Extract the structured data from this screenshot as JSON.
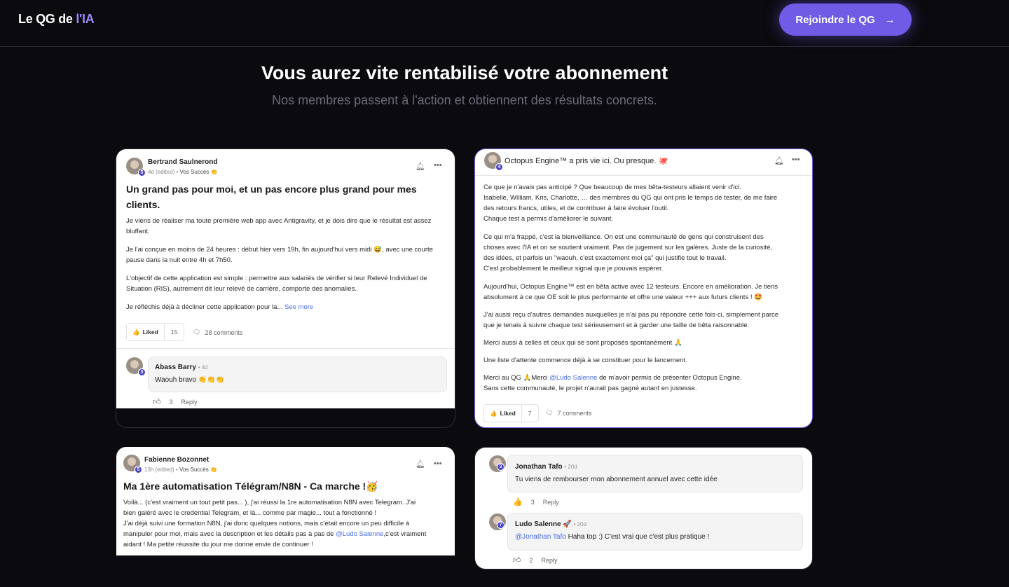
{
  "header": {
    "logo_part1": "Le QG de ",
    "logo_part2": "l'IA",
    "join_label": "Rejoindre le QG",
    "join_arrow": "→"
  },
  "hero": {
    "title": "Vous aurez vite rentabilisé votre abonnement",
    "subtitle": "Nos membres passent à l'action et obtiennent des résultats concrets."
  },
  "post1": {
    "author": "Bertrand Saulnerond",
    "level": "5",
    "time": "4d (edited)",
    "space": "Vos Succès 👏",
    "title": "Un grand pas pour moi, et un pas encore plus grand pour mes clients.",
    "p1": "Je viens de réaliser ma toute première web app avec Antigravity, et je dois dire que le résultat est assez bluffant.",
    "p2": "Je l'ai conçue en moins de 24 heures : début hier vers 19h, fin aujourd'hui vers midi 😅, avec une courte pause dans la nuit entre 4h et 7h50.",
    "p3": "L'objectif de cette application est simple : permettre aux salariés de vérifier si leur Relevé Individuel de Situation (RIS), autrement dit leur relevé de carrière, comporte des anomalies.",
    "p4": "Je réfléchis déjà à décliner cette application pour la...",
    "see_more": "See more",
    "liked_label": "Liked",
    "likes": "15",
    "comments": "28 comments",
    "comment": {
      "author": "Abass Barry",
      "level": "3",
      "time": "4d",
      "text": "Waouh bravo 👏👏👏",
      "likes": "3",
      "reply": "Reply"
    }
  },
  "post2": {
    "author_title": "Octopus Engine™ a pris vie ici. Ou presque. 🐙",
    "level": "4",
    "l1": "Ce que je n'avais pas anticipé ? Que beaucoup de mes bêta-testeurs allaient venir d'ici.",
    "l2": "Isabelle, William, Kris, Charlotte, … des membres du QG qui ont pris le temps de tester, de me faire",
    "l3": "des retours francs, utiles, et de contribuer à faire évoluer l'outil.",
    "l4": "Chaque test a permis d'améliorer le suivant.",
    "l5": "Ce qui m'a frappé, c'est la bienveillance. On est une communauté de gens qui construisent des",
    "l6": "choses avec l'IA et on se soutient vraiment. Pas de jugement sur les galères. Juste de la curiosité,",
    "l7": "des idées, et parfois un \"waouh, c'est exactement moi ça\" qui justifie tout le travail.",
    "l8": "C'est probablement le meilleur signal que je pouvais espérer.",
    "l9": "Aujourd'hui, Octopus Engine™ est en bêta active avec 12 testeurs. Encore en amélioration. Je tiens",
    "l10": "absolument à ce que OE soit le plus performante et offre une valeur +++ aux futurs clients ! 🤩",
    "l11": "J'ai aussi reçu d'autres demandes auxquelles je n'ai pas pu répondre cette fois-ci, simplement parce",
    "l12": "que je tenais à suivre chaque test sérieusement et à garder une taille de bêta raisonnable.",
    "l13": "Merci aussi à celles et ceux qui se sont proposés spontanément 🙏",
    "l14": "Une liste d'attente commence déjà à se constituer pour le lancement.",
    "l15a": "Merci au QG 🙏Merci ",
    "l15link": "@Ludo Salenne",
    "l15b": " de m'avoir permis de présenter Octopus Engine.",
    "l16": "Sans cette communauté, le projet n'aurait pas gagné autant en justesse.",
    "liked_label": "Liked",
    "likes": "7",
    "comments": "7 comments"
  },
  "post3": {
    "author": "Fabienne Bozonnet",
    "level": "5",
    "time": "13h (edited)",
    "space": "Vos Succès 👏",
    "title": "Ma 1ère automatisation Télégram/N8N - Ca marche !🥳",
    "l1": "Voilà... (c'est vraiment un tout petit pas... ), j'ai réussi la 1re automatisation N8N avec Telegram. J'ai",
    "l2": "bien galéré avec le credential Telegram, et là... comme par magie... tout a fonctionné !",
    "l3": "J'ai déjà suivi une formation N8N, j'ai donc quelques notions, mais c'était encore un peu difficile à",
    "l4a": "manipuler pour moi, mais avec la description et les détails pas à pas de ",
    "l4link": "@Ludo Salenne",
    "l4b": ",c'est vraiment",
    "l5": "aidant ! Ma petite réussite du jour me donne envie de continuer !"
  },
  "post4": {
    "c1": {
      "author": "Jonathan Tafo",
      "level": "3",
      "time": "20d",
      "text": "Tu viens de rembourser mon abonnement annuel avec cette idée",
      "likes": "3",
      "reply": "Reply"
    },
    "c2": {
      "author": "Ludo Salenne 🚀",
      "level": "7",
      "time": "20d",
      "mention": "@Jonathan Tafo",
      "text": " Haha top :) C'est vrai que c'est plus pratique !",
      "likes": "2",
      "reply": "Reply"
    }
  },
  "icons": {
    "bell": "bell-icon",
    "more": "more-icon",
    "thumb": "thumbs-up-icon",
    "comment": "comment-icon"
  }
}
